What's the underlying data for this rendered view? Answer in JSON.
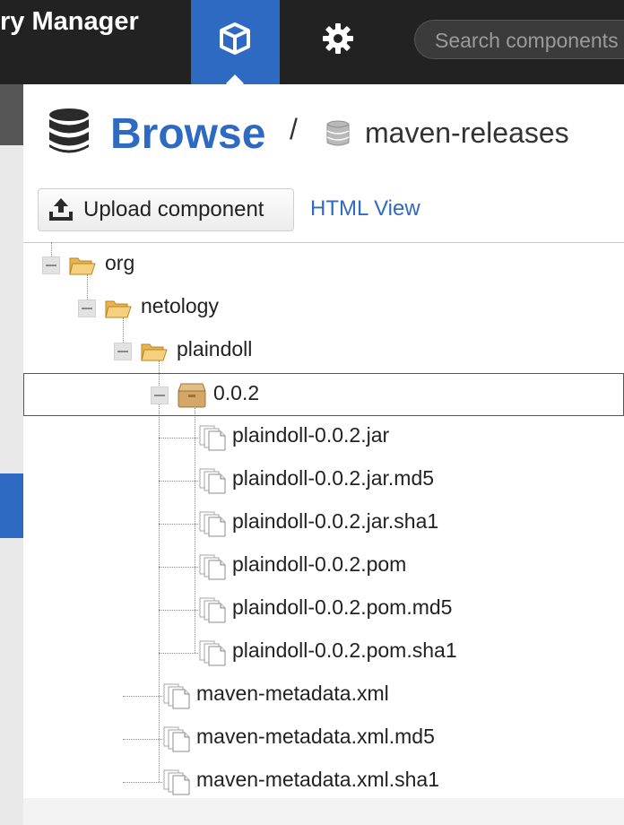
{
  "app": {
    "title": "ry Manager"
  },
  "header": {
    "browse_mode_icon": "cube-icon",
    "admin_mode_icon": "gear-icon",
    "search": {
      "placeholder": "Search components",
      "value": ""
    }
  },
  "breadcrumb": {
    "title": "Browse",
    "separator": "/",
    "repository": "maven-releases"
  },
  "toolbar": {
    "upload_label": "Upload component",
    "html_view_label": "HTML View"
  },
  "tree": {
    "nodes": [
      {
        "label": "org",
        "type": "folder",
        "depth": 0,
        "expanded": true
      },
      {
        "label": "netology",
        "type": "folder",
        "depth": 1,
        "expanded": true
      },
      {
        "label": "plaindoll",
        "type": "folder",
        "depth": 2,
        "expanded": true
      },
      {
        "label": "0.0.2",
        "type": "component",
        "depth": 3,
        "expanded": true,
        "selected": true
      },
      {
        "label": "plaindoll-0.0.2.jar",
        "type": "asset",
        "depth": 4
      },
      {
        "label": "plaindoll-0.0.2.jar.md5",
        "type": "asset",
        "depth": 4
      },
      {
        "label": "plaindoll-0.0.2.jar.sha1",
        "type": "asset",
        "depth": 4
      },
      {
        "label": "plaindoll-0.0.2.pom",
        "type": "asset",
        "depth": 4
      },
      {
        "label": "plaindoll-0.0.2.pom.md5",
        "type": "asset",
        "depth": 4
      },
      {
        "label": "plaindoll-0.0.2.pom.sha1",
        "type": "asset",
        "depth": 4
      },
      {
        "label": "maven-metadata.xml",
        "type": "asset",
        "depth": 3
      },
      {
        "label": "maven-metadata.xml.md5",
        "type": "asset",
        "depth": 3
      },
      {
        "label": "maven-metadata.xml.sha1",
        "type": "asset",
        "depth": 3
      }
    ]
  },
  "colors": {
    "accent": "#2f6ac2",
    "topbar": "#222222",
    "folder": "#f3c56b",
    "component": "#d2a767"
  }
}
